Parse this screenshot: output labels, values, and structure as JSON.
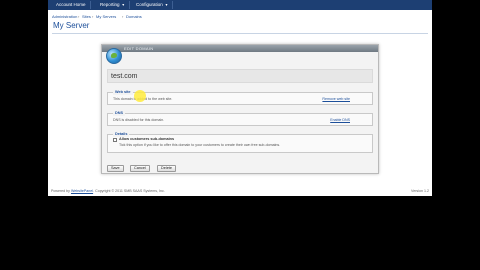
{
  "nav": {
    "tabs": [
      "Account Home",
      "Reporting",
      "Configuration"
    ]
  },
  "breadcrumb": [
    "Administration",
    "Sites",
    "My Servers",
    "Domains"
  ],
  "page_title": "My Server",
  "dialog": {
    "header_text": "EDIT DOMAIN",
    "domain_name": "test.com",
    "web_site": {
      "legend": "Web site",
      "status_text": "This domain is added to the web site.",
      "action_link": "Remove web site"
    },
    "dns": {
      "legend": "DNS",
      "status_text": "DNS is disabled for this domain.",
      "action_link": "Enable DNS"
    },
    "details": {
      "legend": "Details",
      "checkbox_label": "Allow customers sub-domains",
      "checkbox_checked": false,
      "help_text": "Tick this option if you like to offer this domain to your customers to create their own free sub-domains."
    },
    "buttons": {
      "save": "Save",
      "cancel": "Cancel",
      "delete": "Delete"
    }
  },
  "footer": {
    "powered_prefix": "Powered by",
    "powered_link": "WebsitePanel",
    "copyright": "Copyright © 2011 SMB SAAS Systems, Inc.",
    "version": "Version 1.2"
  },
  "colors": {
    "nav_bg": "#1d3f73",
    "link": "#1d4f9a",
    "highlight": "#ffeb3c"
  }
}
